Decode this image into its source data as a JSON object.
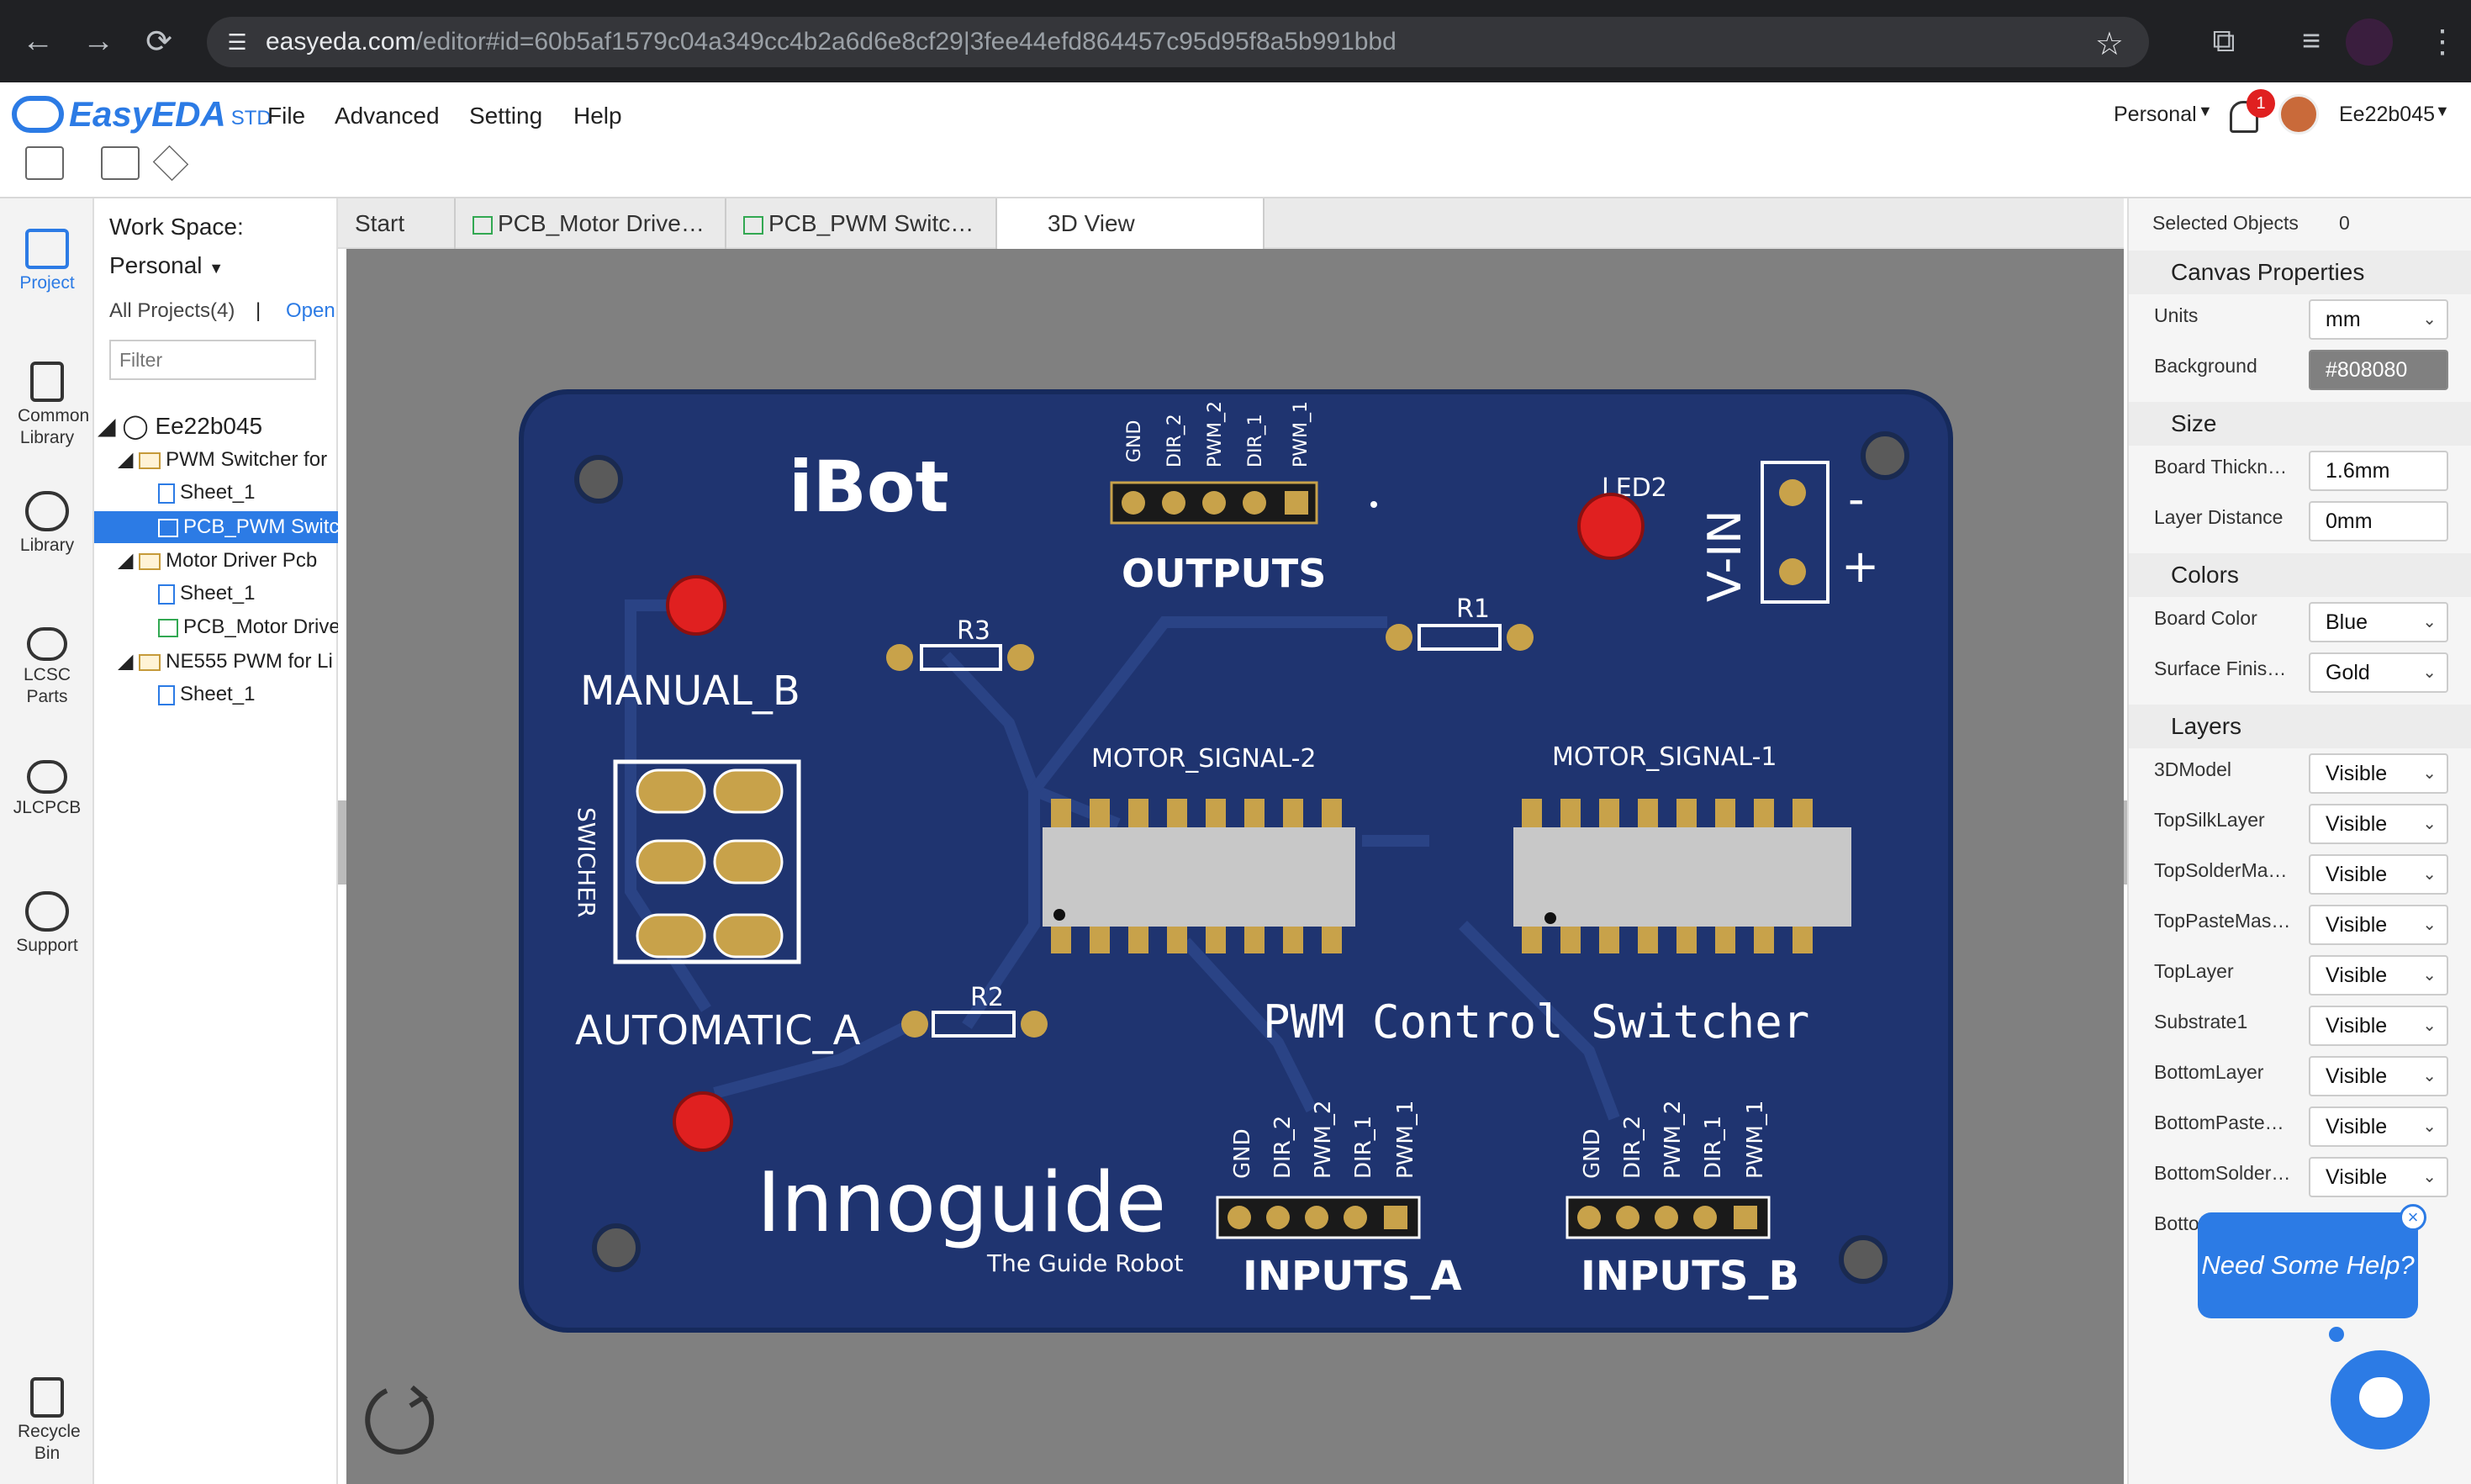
{
  "browser": {
    "url_host": "easyeda.com",
    "url_path": "/editor#id=60b5af1579c04a349cc4b2a6d6e8cf29|3fee44efd864457c95d95f8a5b991bbd"
  },
  "app": {
    "logo": "EasyEDA",
    "logo_suffix": "STD",
    "menus": [
      "File",
      "Advanced",
      "Setting",
      "Help"
    ],
    "workspace_selector": "Personal",
    "notif_count": "1",
    "username": "Ee22b045"
  },
  "rail": [
    "Project",
    "Common Library",
    "Library",
    "LCSC Parts",
    "JLCPCB",
    "Support",
    "Recycle Bin"
  ],
  "project": {
    "workspace_label": "Work Space:",
    "workspace_value": "Personal",
    "all_projects": "All Projects(4)",
    "sep": "|",
    "open": "Open",
    "filter_placeholder": "Filter",
    "tree": [
      "Ee22b045",
      "PWM Switcher for",
      "Sheet_1",
      "PCB_PWM Switc",
      "Motor Driver Pcb",
      "Sheet_1",
      "PCB_Motor Drive",
      "NE555 PWM for Li",
      "Sheet_1"
    ]
  },
  "tabs": [
    "Start",
    "PCB_Motor Drive…",
    "PCB_PWM Switc…",
    "3D View"
  ],
  "pcb": {
    "ibot": "iBot",
    "outputs": "OUTPUTS",
    "outputs_pins": [
      "GND",
      "DIR_2",
      "PWM_2",
      "DIR_1",
      "PWM_1"
    ],
    "led2": "LED2",
    "vin": "V-IN",
    "minus": "-",
    "plus": "+",
    "r1": "R1",
    "r2": "R2",
    "r3": "R3",
    "manual": "MANUAL_B",
    "automatic": "AUTOMATIC_A",
    "switcher": "SWICHER",
    "motor2": "MOTOR_SIGNAL-2",
    "motor1": "MOTOR_SIGNAL-1",
    "pwm_title": "PWM Control Switcher",
    "brand": "Innoguide",
    "tagline": "The Guide Robot",
    "inputs_a": "INPUTS_A",
    "inputs_b": "INPUTS_B",
    "inputs_pins": [
      "GND",
      "DIR_2",
      "PWM_2",
      "DIR_1",
      "PWM_1"
    ]
  },
  "props": {
    "selected_label": "Selected Objects",
    "selected_count": "0",
    "sec_canvas": "Canvas Properties",
    "units_label": "Units",
    "units": "mm",
    "bg_label": "Background",
    "bg": "#808080",
    "sec_size": "Size",
    "thick_label": "Board Thickn…",
    "thick": "1.6mm",
    "layer_dist_label": "Layer Distance",
    "layer_dist": "0mm",
    "sec_colors": "Colors",
    "board_color_label": "Board Color",
    "board_color": "Blue",
    "finish_label": "Surface Finis…",
    "finish": "Gold",
    "sec_layers": "Layers",
    "layers": [
      {
        "name": "3DModel",
        "value": "Visible"
      },
      {
        "name": "TopSilkLayer",
        "value": "Visible"
      },
      {
        "name": "TopSolderMa…",
        "value": "Visible"
      },
      {
        "name": "TopPasteMas…",
        "value": "Visible"
      },
      {
        "name": "TopLayer",
        "value": "Visible"
      },
      {
        "name": "Substrate1",
        "value": "Visible"
      },
      {
        "name": "BottomLayer",
        "value": "Visible"
      },
      {
        "name": "BottomPaste…",
        "value": "Visible"
      },
      {
        "name": "BottomSolder…",
        "value": "Visible"
      },
      {
        "name": "Botto",
        "value": ""
      }
    ]
  },
  "help": {
    "text": "Need Some Help?",
    "close": "×"
  },
  "colors": {
    "board": "#1f3470",
    "gold": "#c8a24a",
    "led": "#e02020",
    "accent": "#2c7be5"
  }
}
